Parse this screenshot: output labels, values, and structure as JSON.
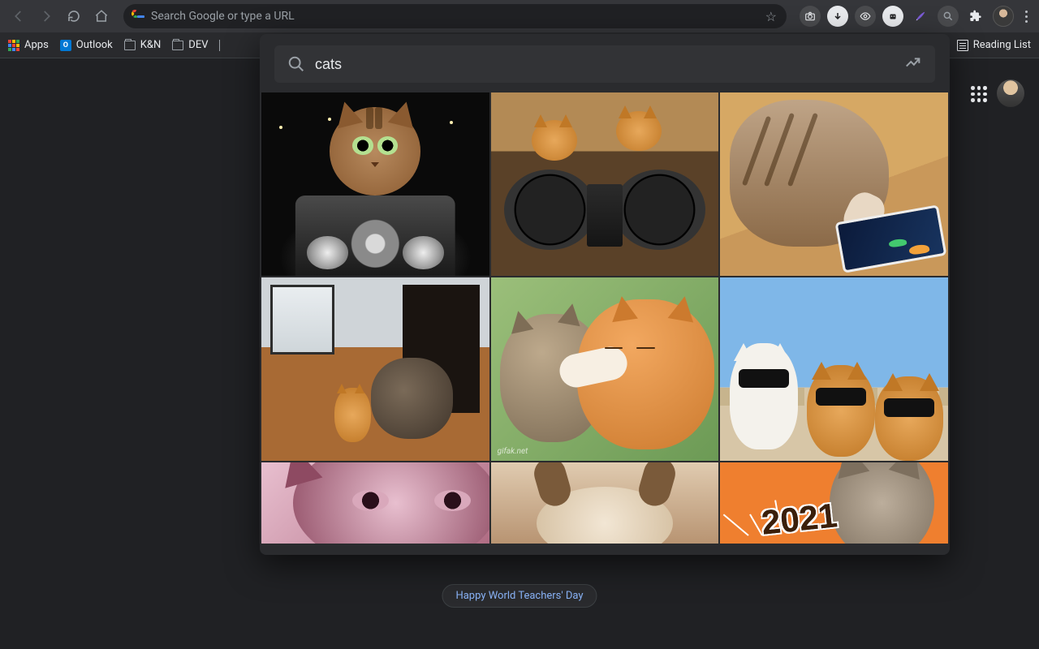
{
  "toolbar": {
    "omnibox_placeholder": "Search Google or type a URL"
  },
  "bookmarks": {
    "apps": "Apps",
    "outlook": "Outlook",
    "folder1": "K&N",
    "folder2": "DEV",
    "reading_list": "Reading List"
  },
  "picker": {
    "search_value": "cats",
    "results": [
      {
        "name": "cat-motorcycle",
        "alt": "kitten riding motorcycle at night"
      },
      {
        "name": "cat-dj",
        "alt": "kittens on DJ turntables"
      },
      {
        "name": "cat-phone",
        "alt": "kitten pawing at phone with fish"
      },
      {
        "name": "cat-kitten-play",
        "alt": "cat playing with kitten on wood floor"
      },
      {
        "name": "cat-hug",
        "alt": "two orange tabby cats hugging",
        "watermark": "gifak.net"
      },
      {
        "name": "cat-sunglasses",
        "alt": "cats wearing sunglasses against sky"
      },
      {
        "name": "cat-pink-closeup",
        "alt": "pink tinted cat face closeup"
      },
      {
        "name": "cat-paws-up",
        "alt": "cat on back with paws up"
      },
      {
        "name": "cat-2021",
        "alt": "cat with 2021 glasses on orange",
        "year": "2021"
      }
    ]
  },
  "ntp": {
    "doodle_chip": "Happy World Teachers' Day"
  }
}
